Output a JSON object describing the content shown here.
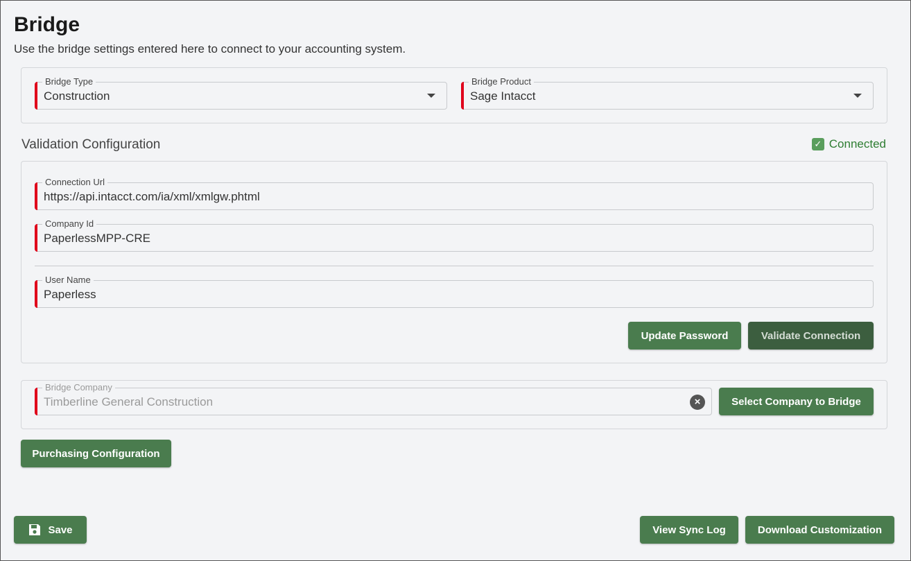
{
  "page": {
    "title": "Bridge",
    "subtitle": "Use the bridge settings entered here to connect to your accounting system."
  },
  "bridge": {
    "type_label": "Bridge Type",
    "type_value": "Construction",
    "product_label": "Bridge Product",
    "product_value": "Sage Intacct"
  },
  "validation": {
    "heading": "Validation Configuration",
    "status": "Connected",
    "status_color": "#2e7d32",
    "connection_url_label": "Connection Url",
    "connection_url_value": "https://api.intacct.com/ia/xml/xmlgw.phtml",
    "company_id_label": "Company Id",
    "company_id_value": "PaperlessMPP-CRE",
    "user_name_label": "User Name",
    "user_name_value": "Paperless",
    "update_password_button": "Update Password",
    "validate_connection_button": "Validate Connection"
  },
  "bridge_company": {
    "label": "Bridge Company",
    "value": "Timberline General Construction",
    "select_button": "Select Company to Bridge"
  },
  "purchasing_button": "Purchasing Configuration",
  "footer": {
    "save_button": "Save",
    "view_sync_log_button": "View Sync Log",
    "download_customization_button": "Download Customization"
  },
  "colors": {
    "accent": "#4a7c4e",
    "required": "#e0001b"
  },
  "icons": {
    "save": "floppy-disk-icon",
    "dropdown": "caret-down-icon",
    "clear": "clear-circle-icon",
    "connected": "checkbox-checked-icon"
  }
}
